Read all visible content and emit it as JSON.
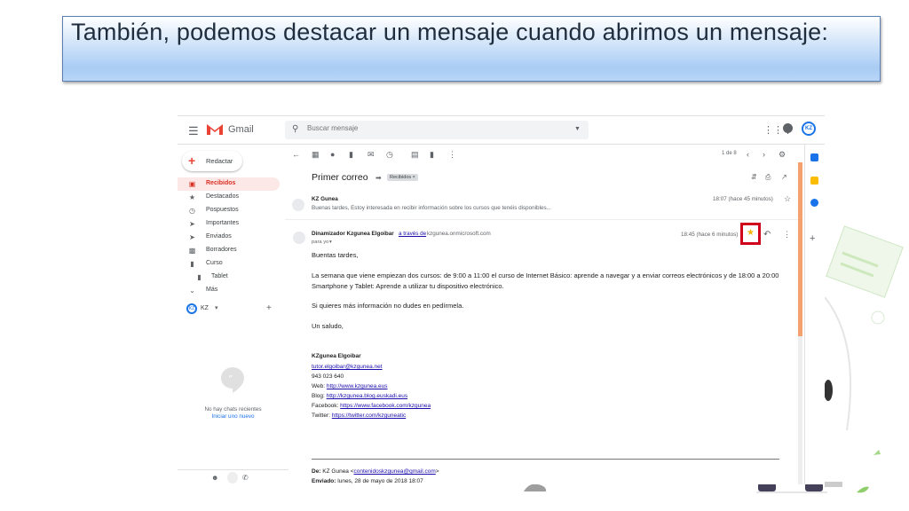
{
  "slide": {
    "title": "También, podemos destacar un mensaje cuando abrimos un mensaje:"
  },
  "gmail": {
    "app_name": "Gmail",
    "search_placeholder": "Buscar mensaje",
    "compose_label": "Redactar",
    "nav": [
      {
        "label": "Recibidos",
        "icon": "inbox-icon",
        "active": true
      },
      {
        "label": "Destacados",
        "icon": "star-icon"
      },
      {
        "label": "Pospuestos",
        "icon": "clock-icon"
      },
      {
        "label": "Importantes",
        "icon": "important-icon"
      },
      {
        "label": "Enviados",
        "icon": "send-icon"
      },
      {
        "label": "Borradores",
        "icon": "draft-icon"
      },
      {
        "label": "Curso",
        "icon": "label-icon"
      },
      {
        "label": "Tablet",
        "icon": "label-icon"
      },
      {
        "label": "Más",
        "icon": "chevron-down-icon"
      }
    ],
    "hangouts_user": "KZ",
    "no_chats": "No hay chats recientes",
    "start_new": "Iniciar uno nuevo",
    "pager": "1 de 8",
    "avatar_initials": "KZ",
    "thread": {
      "subject": "Primer correo",
      "label_chip": "Recibidos ×",
      "first_message": {
        "sender": "KZ Gunea",
        "time": "18:07 (hace 45 minutos)",
        "snippet": "Buenas tardes, Estoy interesada en recibir información sobre los cursos que tenéis disponibles..."
      },
      "second_message": {
        "sender": "Dinamizador Kzgunea Elgoibar",
        "via_label": "a través de",
        "via_domain": "kzgunea.onmicrosoft.com",
        "to": "para yo",
        "time": "18:45 (hace 6 minutos)",
        "greeting": "Buentas tardes,",
        "paragraph": "La semana que viene empiezan dos cursos: de 9:00 a 11:00 el curso de Internet Básico: aprende a navegar y a enviar correos electrónicos y de 18:00 a 20:00 Smartphone y Tablet: Aprende a utilizar tu dispositivo electrónico.",
        "info": "Si quieres más información no dudes en pedírmela.",
        "closing": "Un saludo,",
        "signature": {
          "name": "KZgunea Elgoibar",
          "email": "tutor.elgoibar@kzgunea.net",
          "phone": "943 023 640",
          "web_label": "Web:",
          "web": "http://www.kzgunea.eus",
          "blog_label": "Blog:",
          "blog": "http://kzgunea.blog.euskadi.eus",
          "facebook_label": "Facebook:",
          "facebook": "https://www.facebook.com/kzgunea",
          "twitter_label": "Twitter:",
          "twitter": "https://twitter.com/kzguneatic"
        },
        "quoted_from_label": "De:",
        "quoted_from_name": "KZ Gunea <",
        "quoted_from_email": "contenidoskzgunea@gmail.com",
        "quoted_from_end": ">",
        "quoted_sent_label": "Enviado:",
        "quoted_sent": "lunes, 28 de mayo de 2018 18:07"
      }
    }
  },
  "colors": {
    "accent_red": "#d93025",
    "highlight_box": "#d0021b",
    "star": "#f4b400",
    "link": "#1a0dab"
  }
}
